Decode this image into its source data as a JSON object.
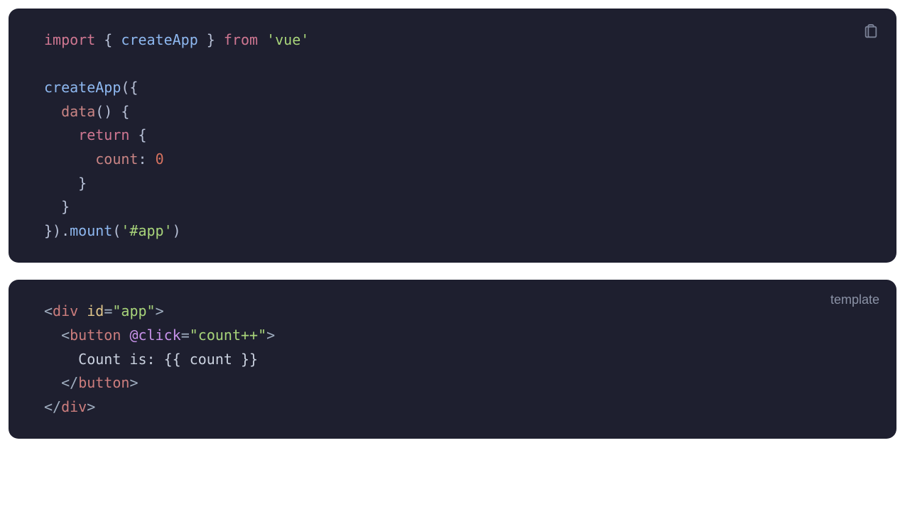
{
  "block1": {
    "tokens": {
      "import": "import",
      "lb1": " { ",
      "createApp": "createApp",
      "rb1": " } ",
      "from": "from",
      "sp1": " ",
      "vue": "'vue'",
      "nl1": "\n\n",
      "createAppCall": "createApp",
      "open": "({",
      "nl2": "\n  ",
      "data": "data",
      "dataParens": "() {",
      "nl3": "\n    ",
      "return": "return",
      "retBrace": " {",
      "nl4": "\n      ",
      "count": "count",
      "colon": ": ",
      "zero": "0",
      "nl5": "\n    ",
      "closeRet": "}",
      "nl6": "\n  ",
      "closeData": "}",
      "nl7": "\n",
      "closeObj": "}).",
      "mount": "mount",
      "mountOpen": "(",
      "appSel": "'#app'",
      "mountClose": ")"
    }
  },
  "block2": {
    "label": "template",
    "tokens": {
      "lt1": "<",
      "div": "div",
      "sp1": " ",
      "idAttr": "id",
      "eq1": "=",
      "appStr": "\"app\"",
      "gt1": ">",
      "nl1": "\n  ",
      "lt2": "<",
      "button": "button",
      "sp2": " ",
      "click": "@click",
      "eq2": "=",
      "countpp": "\"count++\"",
      "gt2": ">",
      "nl2": "\n    ",
      "text": "Count is: {{ count }}",
      "nl3": "\n  ",
      "lt3": "</",
      "buttonClose": "button",
      "gt3": ">",
      "nl4": "\n",
      "lt4": "</",
      "divClose": "div",
      "gt4": ">"
    }
  }
}
